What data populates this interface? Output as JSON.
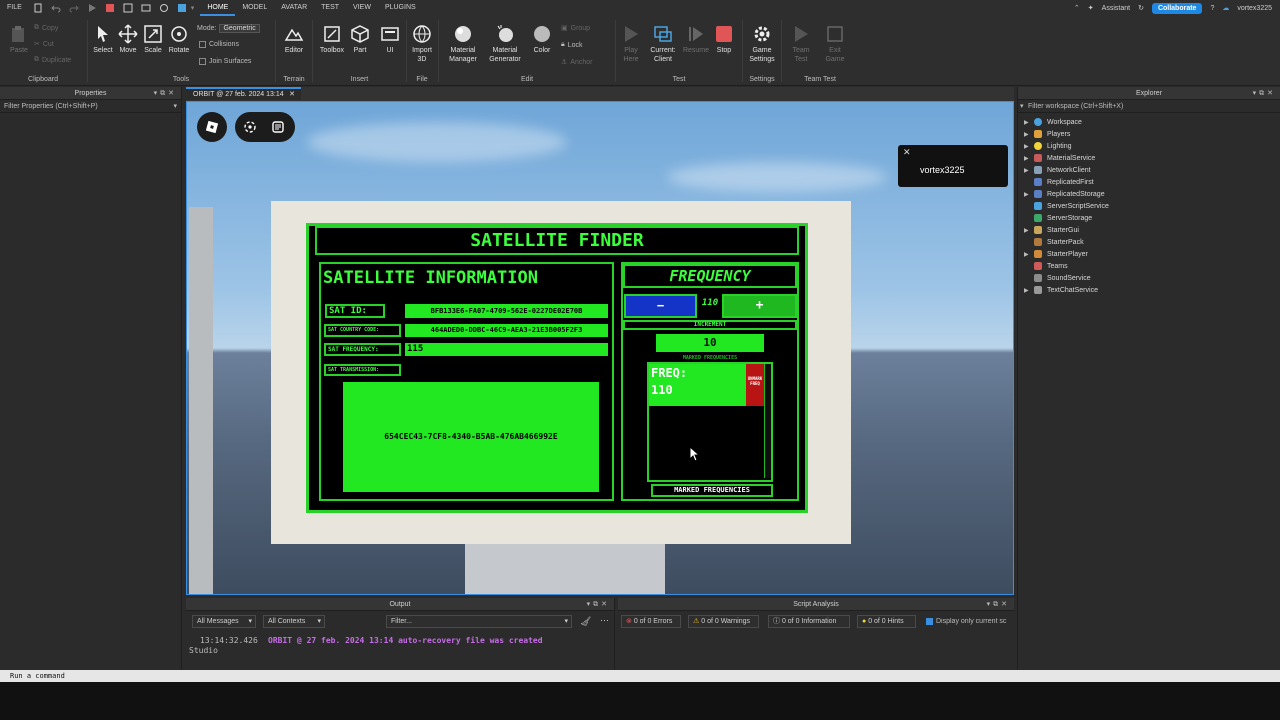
{
  "menubar": {
    "file": "FILE",
    "tabs": [
      "HOME",
      "MODEL",
      "AVATAR",
      "TEST",
      "VIEW",
      "PLUGINS"
    ],
    "active_tab": "HOME",
    "assistant": "Assistant",
    "collaborate": "Collaborate",
    "username": "vortex3225"
  },
  "ribbon": {
    "clipboard": {
      "paste": "Paste",
      "copy": "Copy",
      "cut": "Cut",
      "duplicate": "Duplicate",
      "label": "Clipboard"
    },
    "tools": {
      "select": "Select",
      "move": "Move",
      "scale": "Scale",
      "rotate": "Rotate",
      "mode_label": "Mode:",
      "mode_value": "Geometric",
      "collisions": "Collisions",
      "join_surfaces": "Join Surfaces",
      "label": "Tools"
    },
    "terrain": {
      "editor": "Editor",
      "label": "Terrain"
    },
    "insert": {
      "toolbox": "Toolbox",
      "part": "Part",
      "ui": "UI",
      "label": "Insert"
    },
    "file": {
      "import3d": "Import 3D",
      "label": "File"
    },
    "edit": {
      "material_manager": "Material Manager",
      "material_generator": "Material Generator",
      "color": "Color",
      "group": "Group",
      "lock": "Lock",
      "anchor": "Anchor",
      "label": "Edit"
    },
    "test": {
      "play": "Play Here",
      "current_client": "Current: Client",
      "resume": "Resume",
      "stop": "Stop",
      "label": "Test"
    },
    "settings": {
      "game_settings": "Game Settings",
      "label": "Settings"
    },
    "team_test": {
      "team_test": "Team Test",
      "exit_game": "Exit Game",
      "label": "Team Test"
    }
  },
  "properties": {
    "title": "Properties",
    "filter": "Filter Properties (Ctrl+Shift+P)"
  },
  "document_tab": "ORBIT @ 27 feb. 2024 13:14",
  "viewport": {
    "toast_user": "vortex3225",
    "screen": {
      "title": "SATELLITE FINDER",
      "info_title": "SATELLITE INFORMATION",
      "sat_id_label": "SAT ID:",
      "sat_id_value": "BFB133E6-FA07-4709-562E-0227DE02E70B",
      "country_label": "SAT COUNTRY CODE:",
      "country_value": "464ADED0-DDBC-46C9-AEA3-21E3B005F2F3",
      "freq_label": "SAT FREQUENCY:",
      "freq_value": "115",
      "transmission_label": "SAT TRANSMISSION:",
      "transmission_value": "654CEC43-7CF8-4340-B5AB-476AB466992E",
      "frequency_title": "FREQUENCY",
      "minus": "−",
      "current_freq": "110",
      "plus": "+",
      "increment_label": "INCREMENT",
      "increment_value": "10",
      "marked_small": "MARKED FREQUENCIES",
      "marked_freq_label": "FREQ:",
      "marked_freq_value": "110",
      "unmark_label": "UNMARK FREQ",
      "marked_footer": "MARKED FREQUENCIES"
    }
  },
  "explorer": {
    "title": "Explorer",
    "filter": "Filter workspace (Ctrl+Shift+X)",
    "items": [
      "Workspace",
      "Players",
      "Lighting",
      "MaterialService",
      "NetworkClient",
      "ReplicatedFirst",
      "ReplicatedStorage",
      "ServerScriptService",
      "ServerStorage",
      "StarterGui",
      "StarterPack",
      "StarterPlayer",
      "Teams",
      "SoundService",
      "TextChatService"
    ]
  },
  "output": {
    "title": "Output",
    "all_messages": "All Messages",
    "all_contexts": "All Contexts",
    "filter": "Filter...",
    "log_time": "13:14:32.426",
    "log_message": "ORBIT @ 27 feb. 2024 13:14 auto-recovery file was created",
    "log_source": "Studio"
  },
  "script_analysis": {
    "title": "Script Analysis",
    "errors": "0 of 0 Errors",
    "warnings": "0 of 0 Warnings",
    "information": "0 of 0 Information",
    "hints": "0 of 0 Hints",
    "display_only": "Display only current sc"
  },
  "command_bar": "Run a command",
  "colors": {
    "accent": "#3b8fe0",
    "screen_green": "#22e822",
    "stop_red": "#e05555"
  }
}
